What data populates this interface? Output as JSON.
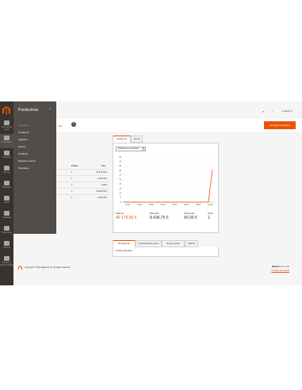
{
  "nav": {
    "items": [
      {
        "icon": "dashboard-icon",
        "label": "Informacinis skydas"
      },
      {
        "icon": "dollar-icon",
        "label": "Pardavimai"
      },
      {
        "icon": "box-icon",
        "label": "Katalogas"
      },
      {
        "icon": "person-icon",
        "label": "Klientai"
      },
      {
        "icon": "megaphone-icon",
        "label": "Rinkodara"
      },
      {
        "icon": "layout-icon",
        "label": "Turinys"
      },
      {
        "icon": "bars-icon",
        "label": "Ataskaitos"
      },
      {
        "icon": "store-icon",
        "label": "Parduotuvės"
      },
      {
        "icon": "gear-icon",
        "label": "Sistema"
      },
      {
        "icon": "puzzle-icon",
        "label": "Partnerių ir plėtinių paieška"
      }
    ]
  },
  "flyout": {
    "title": "Pardavimai",
    "close": "×",
    "section": "Operacijos",
    "items": [
      "Užsakymai",
      "Sąskaitos",
      "Siuntos",
      "Kreditinės",
      "Mokėjimo sutartis",
      "Operacijos"
    ]
  },
  "topbar": {
    "user": "admin"
  },
  "subbar": {
    "scope": "…rtės",
    "help": "?",
    "reload_button": "Atnaujinti Statistiką"
  },
  "left_table": {
    "headers": [
      "Prekės",
      "Viso"
    ],
    "rows": [
      [
        "1",
        "40 175,00 €"
      ],
      [
        "1",
        "2 000,00 €"
      ],
      [
        "1",
        "2,00 €"
      ],
      [
        "1",
        "15 000,00 €"
      ],
      [
        "1",
        "3 000,00 €"
      ]
    ]
  },
  "dashboard": {
    "tabs": [
      "Užsakymai",
      "Sumos"
    ],
    "period": "Paskutinės 24 valandos",
    "period_arrow": "▾",
    "totals": [
      {
        "label": "Pajamos",
        "value": "40 175,00 €",
        "accent": true
      },
      {
        "label": "Mokesčiai",
        "value": "8 436,75 €",
        "accent": false
      },
      {
        "label": "Pristatymas",
        "value": "60,00 €",
        "accent": false
      },
      {
        "label": "Kiekis",
        "value": "1",
        "accent": false
      }
    ]
  },
  "chart_data": {
    "type": "line",
    "x": [
      "10:00",
      "12:00",
      "14:00",
      "16:00",
      "18:00",
      "20:00",
      "22:00",
      "00:00",
      "02:00",
      "04:00",
      "06:00",
      "08:00"
    ],
    "xticks": [
      "10:00",
      "14:00",
      "18:00",
      "22:00",
      "02:00",
      "06:00",
      "08:00",
      "10:00"
    ],
    "ylim": [
      0,
      50
    ],
    "yticks": [
      0,
      5,
      10,
      15,
      20,
      25,
      30,
      35,
      40,
      45,
      50
    ],
    "series": [
      {
        "values": [
          0,
          0,
          0,
          0,
          0,
          0,
          0,
          0,
          0,
          0,
          0,
          0,
          0,
          0,
          0,
          0,
          0,
          0,
          0,
          0,
          0,
          0,
          36
        ]
      }
    ],
    "color": "#eb5202"
  },
  "lower": {
    "tabs": [
      "Bestselleriai",
      "Populiariausios prekės",
      "Naujos prekės",
      "Klientai"
    ],
    "message": "Nerasta jokių įrašų."
  },
  "footer": {
    "copyright": "Copyright © 2017 Magento Inc. All rights reserved.",
    "version_label": "Magento",
    "version": "ver. 2.1.9",
    "report": "Pranešti apie klaidą"
  }
}
